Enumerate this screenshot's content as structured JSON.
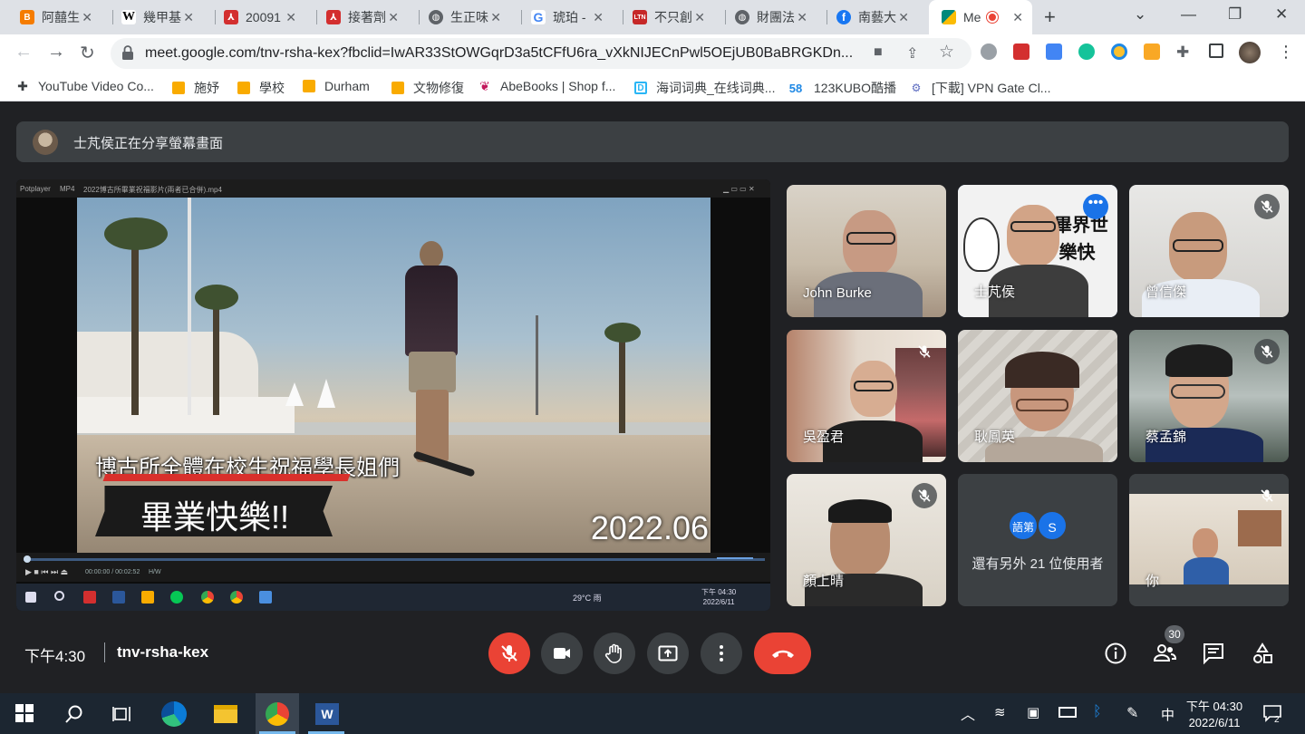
{
  "browser": {
    "tabs": [
      {
        "title": "阿囍生",
        "favicon": "blogger",
        "color": "#f57c00"
      },
      {
        "title": "幾甲基",
        "favicon": "wikipedia",
        "color": "#000000"
      },
      {
        "title": "20091",
        "favicon": "pdf",
        "color": "#d32f2f"
      },
      {
        "title": "接著劑",
        "favicon": "pdf",
        "color": "#d32f2f"
      },
      {
        "title": "生正味",
        "favicon": "globe",
        "color": "#5f6368"
      },
      {
        "title": "琥珀 -",
        "favicon": "google",
        "color": "#4285f4"
      },
      {
        "title": "不只創",
        "favicon": "ltn",
        "color": "#c62828"
      },
      {
        "title": "財團法",
        "favicon": "globe",
        "color": "#5f6368"
      },
      {
        "title": "南藝大",
        "favicon": "facebook",
        "color": "#1877f2"
      },
      {
        "title": "Me",
        "favicon": "meet",
        "color": "#00897b",
        "active": true
      }
    ],
    "new_tab_label": "+",
    "url": "meet.google.com/tnv-rsha-kex?fbclid=IwAR33StOWGqrD3a5tCFfU6ra_vXkNIJECnPwl5OEjUB0BaBRGKDn...",
    "bookmarks": [
      {
        "label": "YouTube Video Co...",
        "icon": "puzzle",
        "color": "#3c4043"
      },
      {
        "label": "施妤",
        "icon": "folder",
        "color": "#f9ab00"
      },
      {
        "label": "學校",
        "icon": "folder",
        "color": "#f9ab00"
      },
      {
        "label": "Durham",
        "icon": "folder",
        "color": "#f9ab00"
      },
      {
        "label": "文物修復",
        "icon": "folder",
        "color": "#f9ab00"
      },
      {
        "label": "AbeBooks | Shop f...",
        "icon": "abebooks",
        "color": "#c2185b"
      },
      {
        "label": "海词词典_在线词典...",
        "icon": "dict",
        "color": "#29b6f6"
      },
      {
        "label": "123KUBO酷播",
        "icon": "58",
        "color": "#1e88e5"
      },
      {
        "label": "[下載] VPN Gate Cl...",
        "icon": "vpn",
        "color": "#5c6bc0"
      }
    ]
  },
  "meet": {
    "presenting_banner": "士芃侯正在分享螢幕畫面",
    "presentation": {
      "player_name": "Potplayer",
      "player_format": "MP4",
      "file_name": "2022博古所畢業祝福影片(兩者已合併).mp4",
      "subtitle": "博古所全體在校生祝福學長姐們",
      "title": "畢業快樂!!",
      "date": "2022.06",
      "time": "00:00:00 / 00:02:52",
      "mode": "H/W",
      "weather": "29°C 雨",
      "clock_time": "下午 04:30",
      "clock_date": "2022/6/11"
    },
    "participants": [
      {
        "name": "John Burke",
        "muted": false
      },
      {
        "name": "士芃侯",
        "muted": false,
        "speaking": true
      },
      {
        "name": "曾信傑",
        "muted": true
      },
      {
        "name": "吳盈君",
        "muted": true
      },
      {
        "name": "耿鳳英",
        "muted": false
      },
      {
        "name": "蔡孟錦",
        "muted": true
      },
      {
        "name": "顏上晴",
        "muted": true
      },
      {
        "name": "你",
        "muted": true
      }
    ],
    "others": {
      "avatars": [
        {
          "label": "語第",
          "color": "#1a73e8"
        },
        {
          "label": "S",
          "color": "#1a73e8"
        }
      ],
      "text": "還有另外 21 位使用者"
    },
    "meeting_time": "下午4:30",
    "meeting_code": "tnv-rsha-kex",
    "people_count": "30"
  },
  "taskbar": {
    "clock_time": "下午 04:30",
    "clock_date": "2022/6/11",
    "language": "中",
    "notifications": "2"
  }
}
